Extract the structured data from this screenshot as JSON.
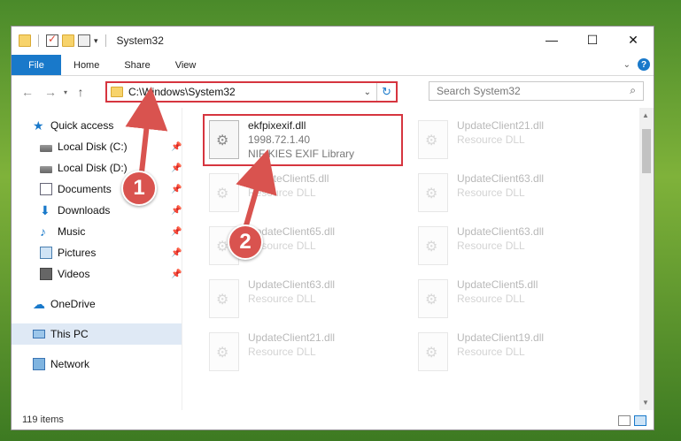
{
  "window": {
    "title": "System32",
    "controls": {
      "minimize": "—",
      "maximize": "☐",
      "close": "✕"
    }
  },
  "ribbon": {
    "tabs": [
      "File",
      "Home",
      "Share",
      "View"
    ],
    "help_icon": "?"
  },
  "nav": {
    "back": "←",
    "forward": "→",
    "recent": "▾",
    "up": "↑",
    "address": "C:\\Windows\\System32",
    "refresh": "↻",
    "search_placeholder": "Search System32"
  },
  "sidebar": {
    "quick_access": "Quick access",
    "items": [
      {
        "label": "Local Disk (C:)",
        "icon": "drive-icon"
      },
      {
        "label": "Local Disk (D:)",
        "icon": "drive-icon"
      },
      {
        "label": "Documents",
        "icon": "documents-icon"
      },
      {
        "label": "Downloads",
        "icon": "downloads-icon"
      },
      {
        "label": "Music",
        "icon": "music-icon"
      },
      {
        "label": "Pictures",
        "icon": "pictures-icon"
      },
      {
        "label": "Videos",
        "icon": "videos-icon"
      }
    ],
    "onedrive": "OneDrive",
    "this_pc": "This PC",
    "network": "Network"
  },
  "files": [
    {
      "name": "ekfpixexif.dll",
      "line2": "1998.72.1.40",
      "line3": "NIF KIES EXIF Library"
    },
    {
      "name": "UpdateClient21.dll",
      "line2": "Resource DLL"
    },
    {
      "name": "UpdateClient5.dll",
      "line2": "Resource DLL"
    },
    {
      "name": "UpdateClient63.dll",
      "line2": "Resource DLL"
    },
    {
      "name": "UpdateClient65.dll",
      "line2": "Resource DLL"
    },
    {
      "name": "UpdateClient63.dll",
      "line2": "Resource DLL"
    },
    {
      "name": "UpdateClient63.dll",
      "line2": "Resource DLL"
    },
    {
      "name": "UpdateClient5.dll",
      "line2": "Resource DLL"
    },
    {
      "name": "UpdateClient21.dll",
      "line2": "Resource DLL"
    },
    {
      "name": "UpdateClient19.dll",
      "line2": "Resource DLL"
    }
  ],
  "status": {
    "item_count": "119 items"
  },
  "annotations": {
    "callout1": "1",
    "callout2": "2",
    "color": "#d9534f"
  }
}
